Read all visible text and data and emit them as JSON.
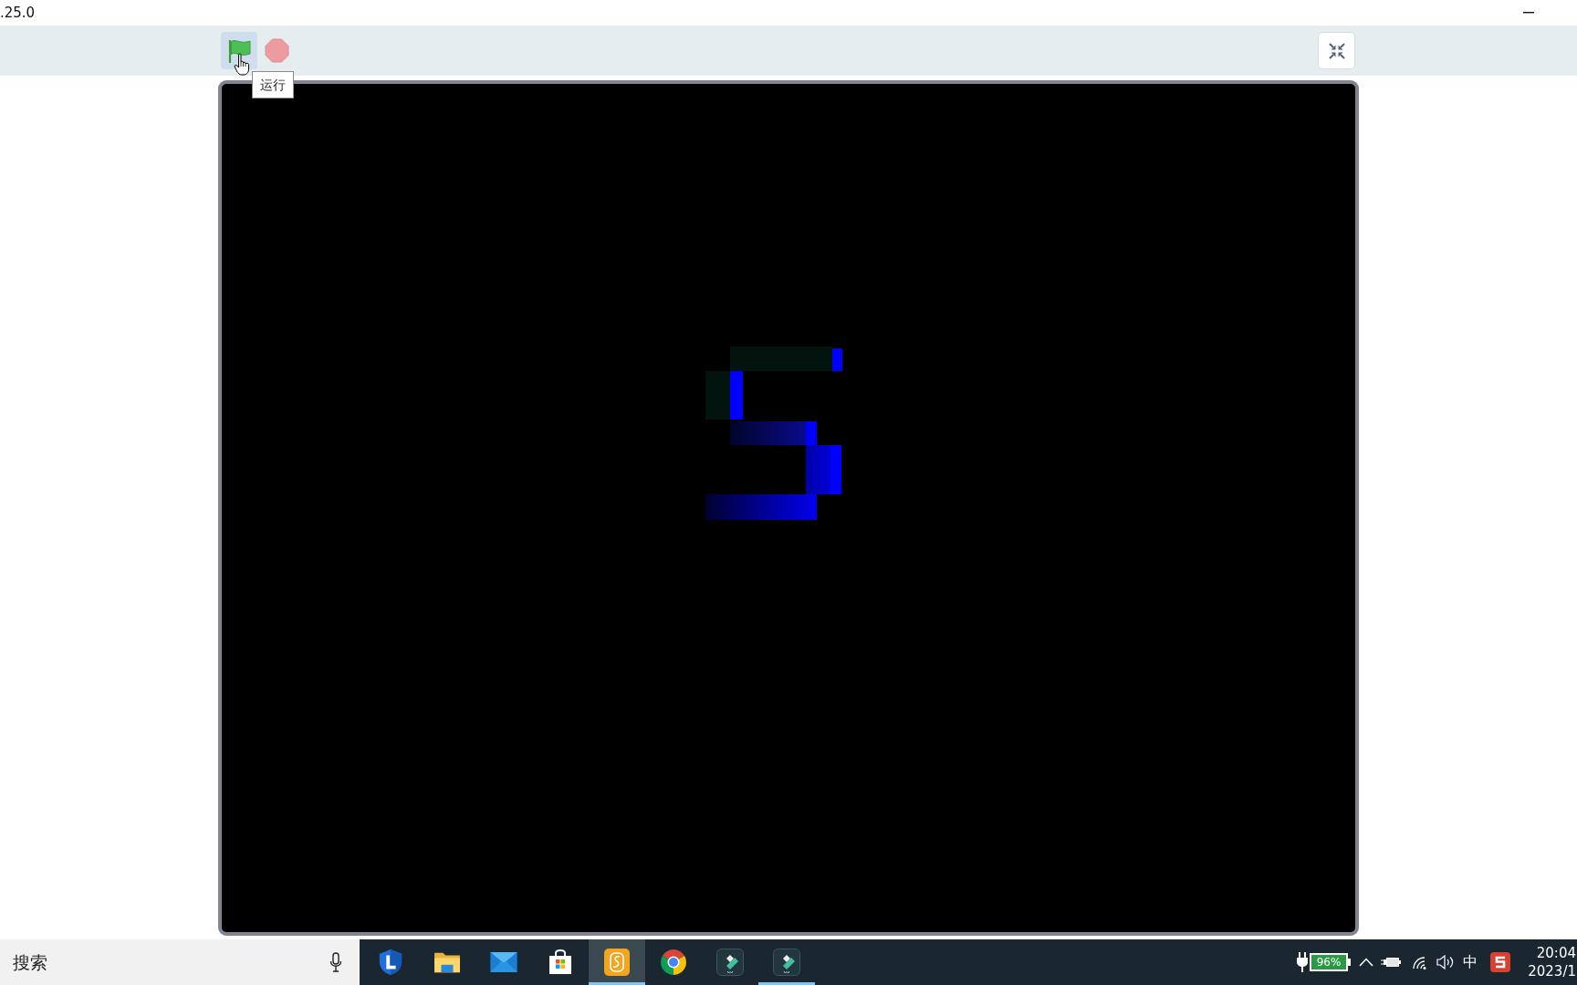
{
  "window": {
    "title": ".25.0"
  },
  "toolbar": {
    "controls": [
      {
        "kind": "flag",
        "hovered": true
      },
      {
        "kind": "stop",
        "hovered": false
      }
    ],
    "tooltip": "运行"
  },
  "taskbar": {
    "search": {
      "placeholder": "搜索"
    },
    "apps": [
      {
        "kind": "shield",
        "selected": false,
        "running": false
      },
      {
        "kind": "folder",
        "selected": false,
        "running": false
      },
      {
        "kind": "mail",
        "selected": false,
        "running": false
      },
      {
        "kind": "store",
        "selected": false,
        "running": false
      },
      {
        "kind": "notes",
        "selected": true,
        "running": true
      },
      {
        "kind": "browser",
        "selected": false,
        "running": false
      },
      {
        "kind": "editor",
        "selected": false,
        "running": false
      },
      {
        "kind": "editor",
        "selected": false,
        "running": true
      }
    ],
    "tray": {
      "battery": "96%",
      "input_method": "中",
      "time": "20:04",
      "date": "2023/1"
    }
  }
}
